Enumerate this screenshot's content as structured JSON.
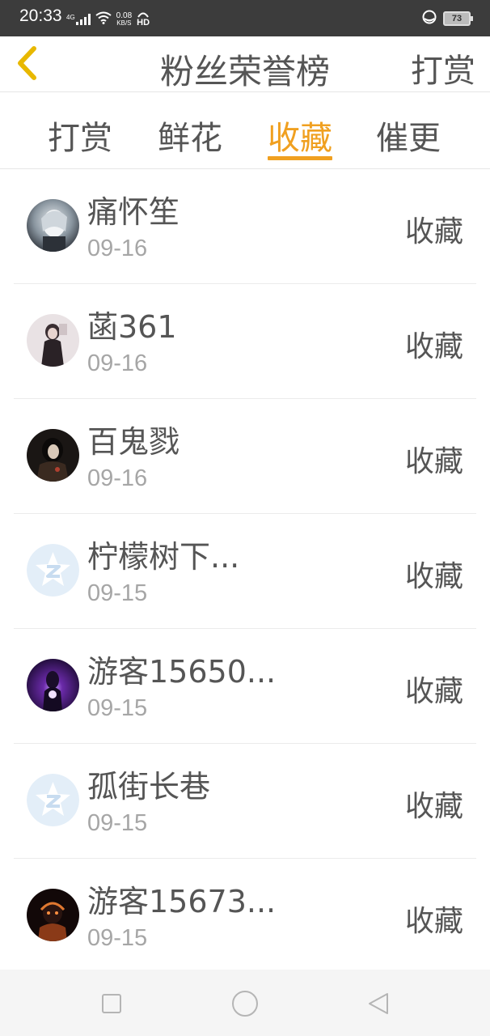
{
  "status_bar": {
    "time": "20:33",
    "network": "4G",
    "speed_value": "0.08",
    "speed_unit": "KB/S",
    "hd": "HD",
    "battery": "73"
  },
  "header": {
    "title": "粉丝荣誉榜",
    "right_action": "打赏",
    "back_icon": "chevron-left-icon",
    "accent_color": "#f0a020"
  },
  "tabs": [
    {
      "label": "打赏",
      "active": false
    },
    {
      "label": "鲜花",
      "active": false
    },
    {
      "label": "收藏",
      "active": true
    },
    {
      "label": "催更",
      "active": false
    }
  ],
  "fans": [
    {
      "name": "痛怀笙",
      "date": "09-16",
      "action": "收藏",
      "avatar": "photo-avatar"
    },
    {
      "name": "菡361",
      "date": "09-16",
      "action": "收藏",
      "avatar": "photo-avatar"
    },
    {
      "name": "百鬼戮",
      "date": "09-16",
      "action": "收藏",
      "avatar": "photo-avatar"
    },
    {
      "name": "柠檬树下...",
      "date": "09-15",
      "action": "收藏",
      "avatar": "default-star-avatar"
    },
    {
      "name": "游客15650...",
      "date": "09-15",
      "action": "收藏",
      "avatar": "photo-avatar"
    },
    {
      "name": "孤街长巷",
      "date": "09-15",
      "action": "收藏",
      "avatar": "default-star-avatar"
    },
    {
      "name": "游客15673...",
      "date": "09-15",
      "action": "收藏",
      "avatar": "photo-avatar"
    }
  ],
  "system_nav": [
    "recent-apps-icon",
    "home-icon",
    "back-icon"
  ]
}
